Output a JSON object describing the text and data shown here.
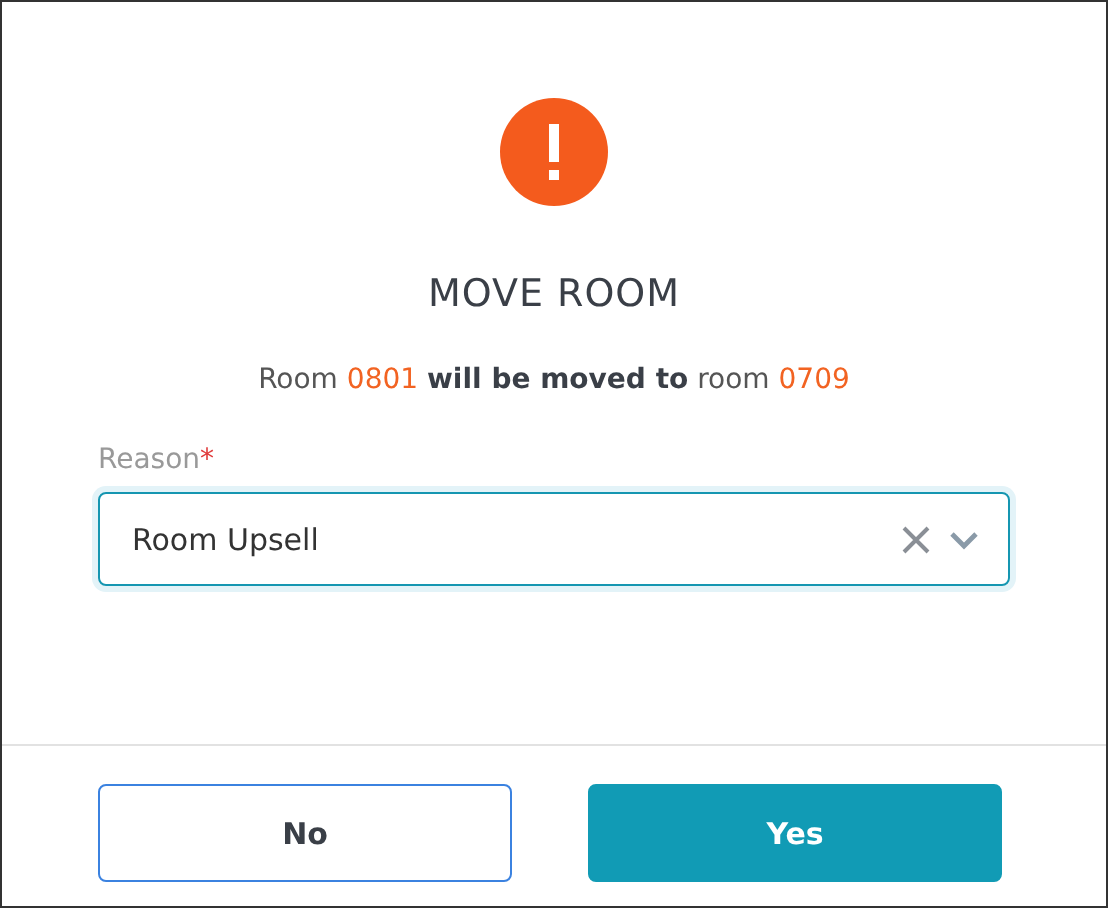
{
  "dialog": {
    "title": "MOVE ROOM",
    "message": [
      {
        "kind": "plain",
        "text": "Room"
      },
      {
        "kind": "highlight",
        "text": "0801"
      },
      {
        "kind": "bold",
        "text": "will be moved to"
      },
      {
        "kind": "plain",
        "text": "room"
      },
      {
        "kind": "highlight",
        "text": "0709"
      }
    ],
    "reason": {
      "label": "Reason",
      "required_mark": "*",
      "value": "Room Upsell",
      "focused": true
    },
    "buttons": [
      {
        "label": "No",
        "kind": "secondary"
      },
      {
        "label": "Yes",
        "kind": "primary"
      }
    ]
  }
}
